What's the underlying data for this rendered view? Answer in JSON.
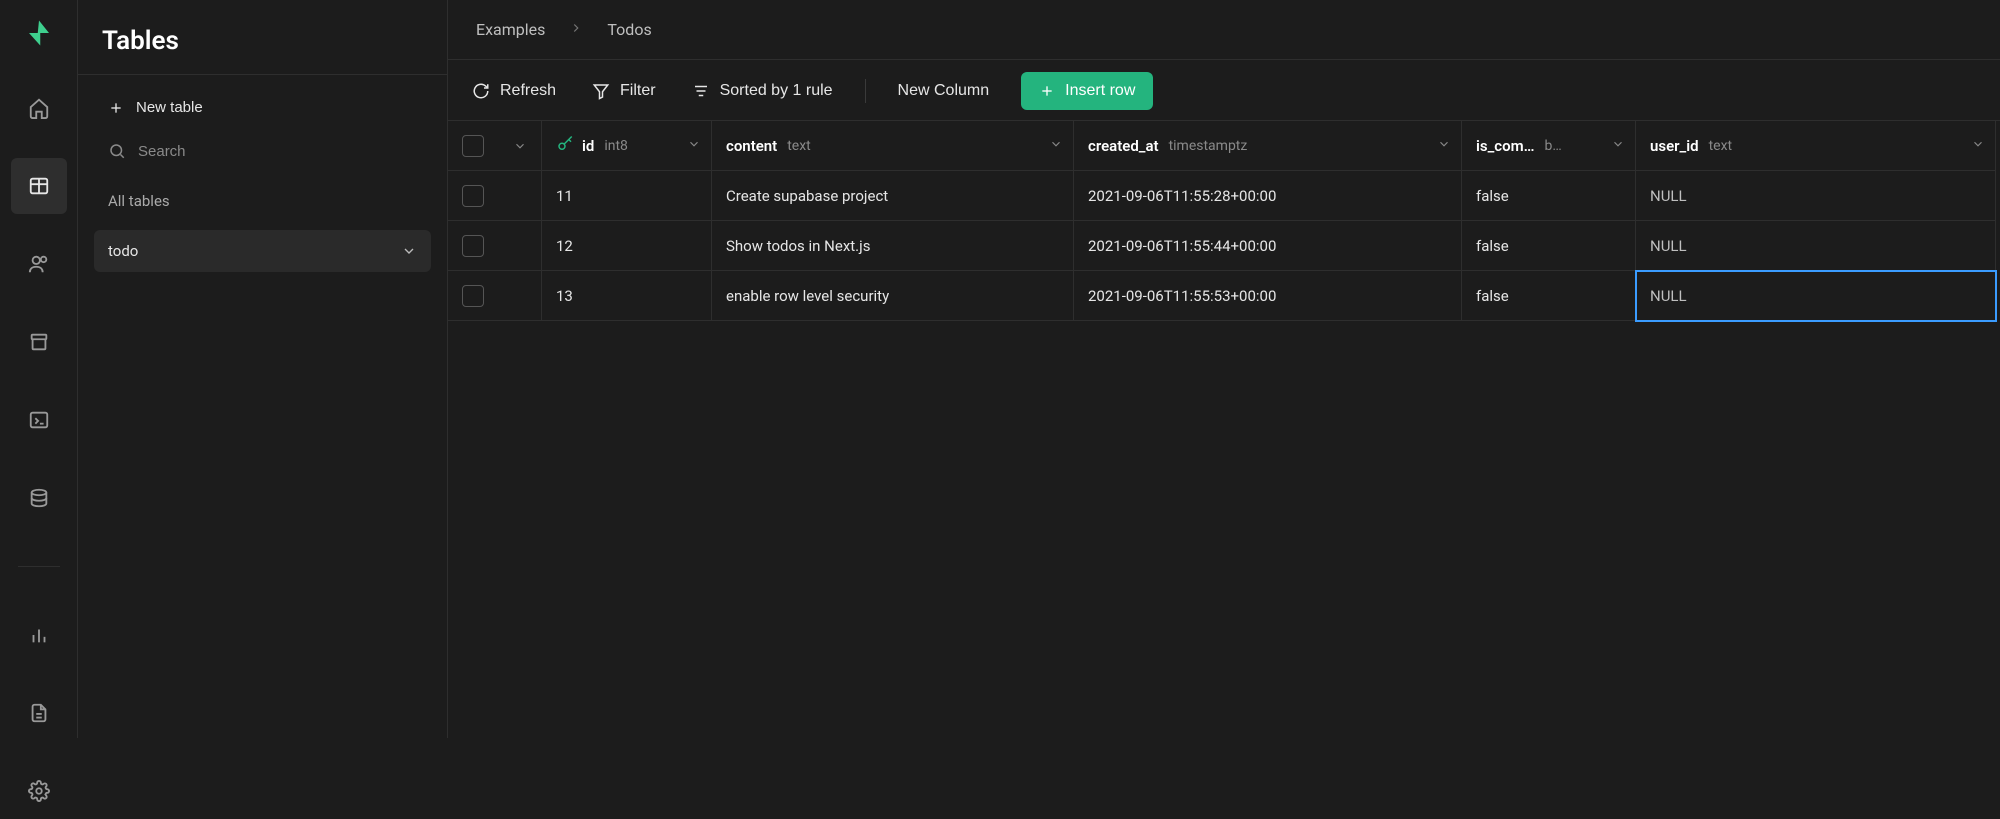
{
  "sidebar": {
    "title": "Tables",
    "new_table_label": "New table",
    "search_placeholder": "Search",
    "all_tables_label": "All tables",
    "selected_table": "todo"
  },
  "breadcrumbs": {
    "project": "Examples",
    "table": "Todos"
  },
  "toolbar": {
    "refresh": "Refresh",
    "filter": "Filter",
    "sorted": "Sorted by 1 rule",
    "new_column": "New Column",
    "insert_row": "Insert row"
  },
  "columns": [
    {
      "name": "id",
      "type": "int8",
      "pk": true
    },
    {
      "name": "content",
      "type": "text",
      "pk": false
    },
    {
      "name": "created_at",
      "type": "timestamptz",
      "pk": false
    },
    {
      "name": "is_com…",
      "type": "b…",
      "pk": false
    },
    {
      "name": "user_id",
      "type": "text",
      "pk": false
    }
  ],
  "rows": [
    {
      "id": "11",
      "content": "Create supabase project",
      "created_at": "2021-09-06T11:55:28+00:00",
      "is_complete": "false",
      "user_id": "NULL"
    },
    {
      "id": "12",
      "content": "Show todos in Next.js",
      "created_at": "2021-09-06T11:55:44+00:00",
      "is_complete": "false",
      "user_id": "NULL"
    },
    {
      "id": "13",
      "content": "enable row level security",
      "created_at": "2021-09-06T11:55:53+00:00",
      "is_complete": "false",
      "user_id": "NULL"
    }
  ],
  "colors": {
    "accent": "#24b47e",
    "selection": "#3b9cff"
  }
}
